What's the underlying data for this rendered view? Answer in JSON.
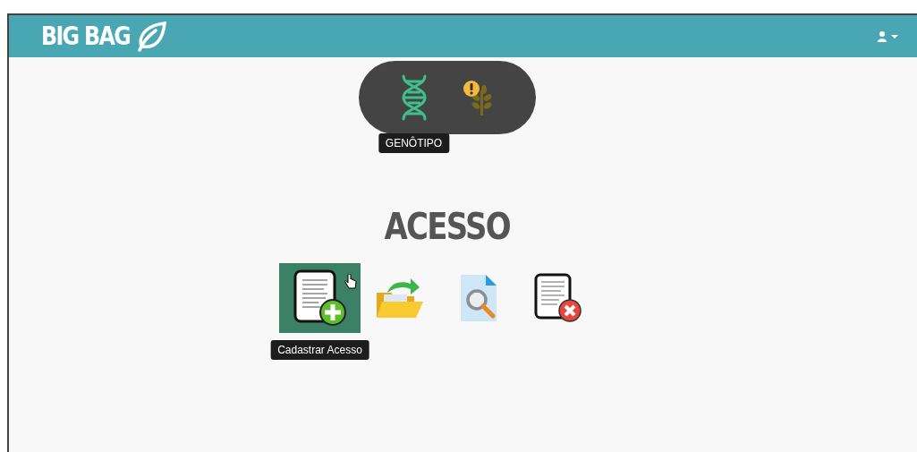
{
  "header": {
    "brand": "BIG BAG"
  },
  "modules": [
    {
      "kind": "dna",
      "selected": true,
      "tooltip": "GENÔTIPO"
    },
    {
      "kind": "plant-alert",
      "selected": false
    }
  ],
  "title": "ACESSO",
  "actions": [
    {
      "kind": "add",
      "selected": true,
      "tooltip": "Cadastrar Acesso"
    },
    {
      "kind": "open",
      "selected": false
    },
    {
      "kind": "search",
      "selected": false
    },
    {
      "kind": "delete",
      "selected": false
    }
  ]
}
